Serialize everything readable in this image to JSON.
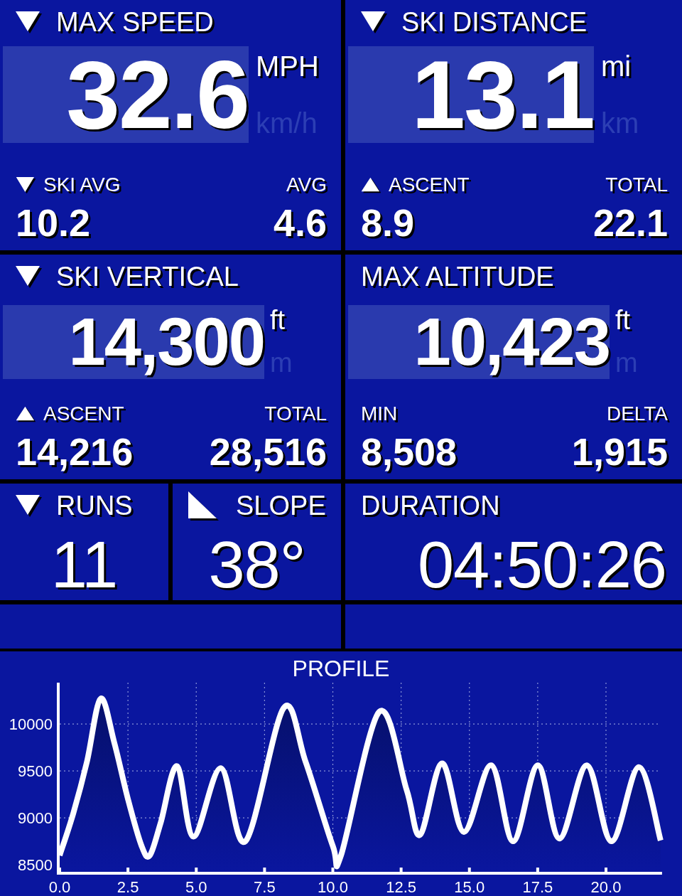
{
  "tiles": [
    {
      "kind": "big",
      "header": {
        "kind": "down",
        "text": "MAX SPEED"
      },
      "value": "32.6",
      "units": [
        {
          "label": "MPH",
          "selected": true
        },
        {
          "label": "km/h",
          "selected": false
        }
      ],
      "stats": [
        {
          "kind": "down",
          "label": "SKI AVG",
          "value": "10.2"
        },
        {
          "kind": "plain",
          "label": "AVG",
          "value": "4.6"
        }
      ]
    },
    {
      "kind": "big",
      "header": {
        "kind": "down",
        "text": "SKI DISTANCE"
      },
      "value": "13.1",
      "units": [
        {
          "label": "mi",
          "selected": true
        },
        {
          "label": "km",
          "selected": false
        }
      ],
      "stats": [
        {
          "kind": "up",
          "label": "ASCENT",
          "value": "8.9"
        },
        {
          "kind": "plain",
          "label": "TOTAL",
          "value": "22.1"
        }
      ]
    },
    {
      "kind": "mid",
      "header": {
        "kind": "down",
        "text": "SKI VERTICAL"
      },
      "value": "14,300",
      "units": [
        {
          "label": "ft",
          "selected": true
        },
        {
          "label": "m",
          "selected": false
        }
      ],
      "stats": [
        {
          "kind": "up",
          "label": "ASCENT",
          "value": "14,216"
        },
        {
          "kind": "plain",
          "label": "TOTAL",
          "value": "28,516"
        }
      ]
    },
    {
      "kind": "mid",
      "header": {
        "kind": "plain",
        "text": "MAX ALTITUDE"
      },
      "value": "10,423",
      "units": [
        {
          "label": "ft",
          "selected": true
        },
        {
          "label": "m",
          "selected": false
        }
      ],
      "stats": [
        {
          "kind": "plain",
          "label": "MIN",
          "value": "8,508"
        },
        {
          "kind": "plain",
          "label": "DELTA",
          "value": "1,915"
        }
      ]
    },
    {
      "kind": "small",
      "header": {
        "kind": "down",
        "text": "RUNS"
      },
      "value": "11"
    },
    {
      "kind": "small",
      "header": {
        "kind": "slope",
        "text": "SLOPE"
      },
      "value": "38°"
    },
    {
      "kind": "wide",
      "header": {
        "kind": "plain",
        "text": "DURATION"
      },
      "value": "04:50:26"
    },
    {
      "kind": "blank"
    },
    {
      "kind": "blank"
    }
  ],
  "profile": {
    "chart_data": {
      "type": "area",
      "title": "PROFILE",
      "grid": true,
      "x": [
        0,
        0.5,
        1,
        1.5,
        2,
        2.5,
        3,
        3.3,
        3.7,
        4.3,
        4.9,
        5.9,
        6.8,
        8.2,
        9,
        10,
        10.3,
        11.7,
        12.7,
        13.2,
        14,
        14.8,
        15.8,
        16.6,
        17.5,
        18.3,
        19.3,
        20.2,
        21.2,
        22
      ],
      "values": [
        8600,
        9050,
        9600,
        10270,
        9800,
        9200,
        8700,
        8600,
        8950,
        9550,
        8800,
        9530,
        8750,
        10170,
        9600,
        8700,
        8600,
        10130,
        9300,
        8820,
        9580,
        8850,
        9560,
        8750,
        9560,
        8780,
        9560,
        8750,
        9540,
        8760
      ],
      "xlim": [
        0,
        22
      ],
      "ylim": [
        8410,
        10440
      ],
      "xticks": [
        {
          "value": 0,
          "label": "0.0"
        },
        {
          "value": 2.5,
          "label": "2.5"
        },
        {
          "value": 5,
          "label": "5.0"
        },
        {
          "value": 7.5,
          "label": "7.5"
        },
        {
          "value": 10,
          "label": "10.0"
        },
        {
          "value": 12.5,
          "label": "12.5"
        },
        {
          "value": 15,
          "label": "15.0"
        },
        {
          "value": 17.5,
          "label": "17.5"
        },
        {
          "value": 20,
          "label": "20.0"
        }
      ],
      "yticks": [
        8500,
        9000,
        9500,
        10000
      ]
    }
  }
}
